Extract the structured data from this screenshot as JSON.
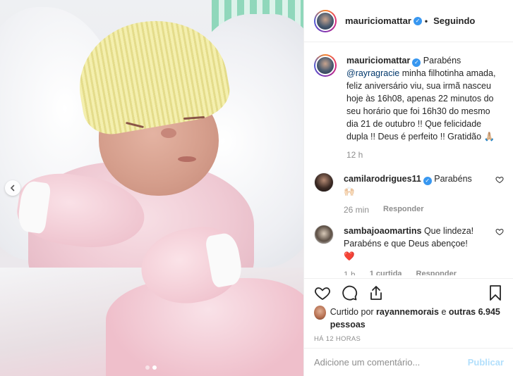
{
  "post": {
    "author": "mauriciomattar",
    "follow_state": "Seguindo",
    "caption_mention": "@rayragracie",
    "caption_first": "Parabéns",
    "caption_text": "minha filhotinha amada, feliz aniversário viu, sua irmã nasceu hoje às 16h08, apenas 22 minutos do seu horário que foi 16h30 do mesmo dia 21 de outubro !! Que felicidade dupla !! Deus é perfeito !! Gratidão 🙏🏼",
    "caption_time": "12 h"
  },
  "comments": [
    {
      "user": "camilarodrigues11",
      "text": "Parabéns 🙌🏻",
      "time": "26 min",
      "reply_label": "Responder"
    },
    {
      "user": "sambajoaomartins",
      "text": "Que lindeza! Parabéns e que Deus abençoe! ❤️",
      "time": "1 h",
      "likes": "1 curtida",
      "reply_label": "Responder"
    }
  ],
  "likes": {
    "prefix": "Curtido por",
    "user": "rayannemorais",
    "connector": "e",
    "others": "outras 6.945 pessoas"
  },
  "posted_ago": "HÁ 12 HORAS",
  "add_comment": {
    "placeholder": "Adicione um comentário...",
    "publish_label": "Publicar"
  },
  "colors": {
    "verified": "#3897f0",
    "link": "#00376b",
    "publish_disabled": "#b2dffc"
  }
}
